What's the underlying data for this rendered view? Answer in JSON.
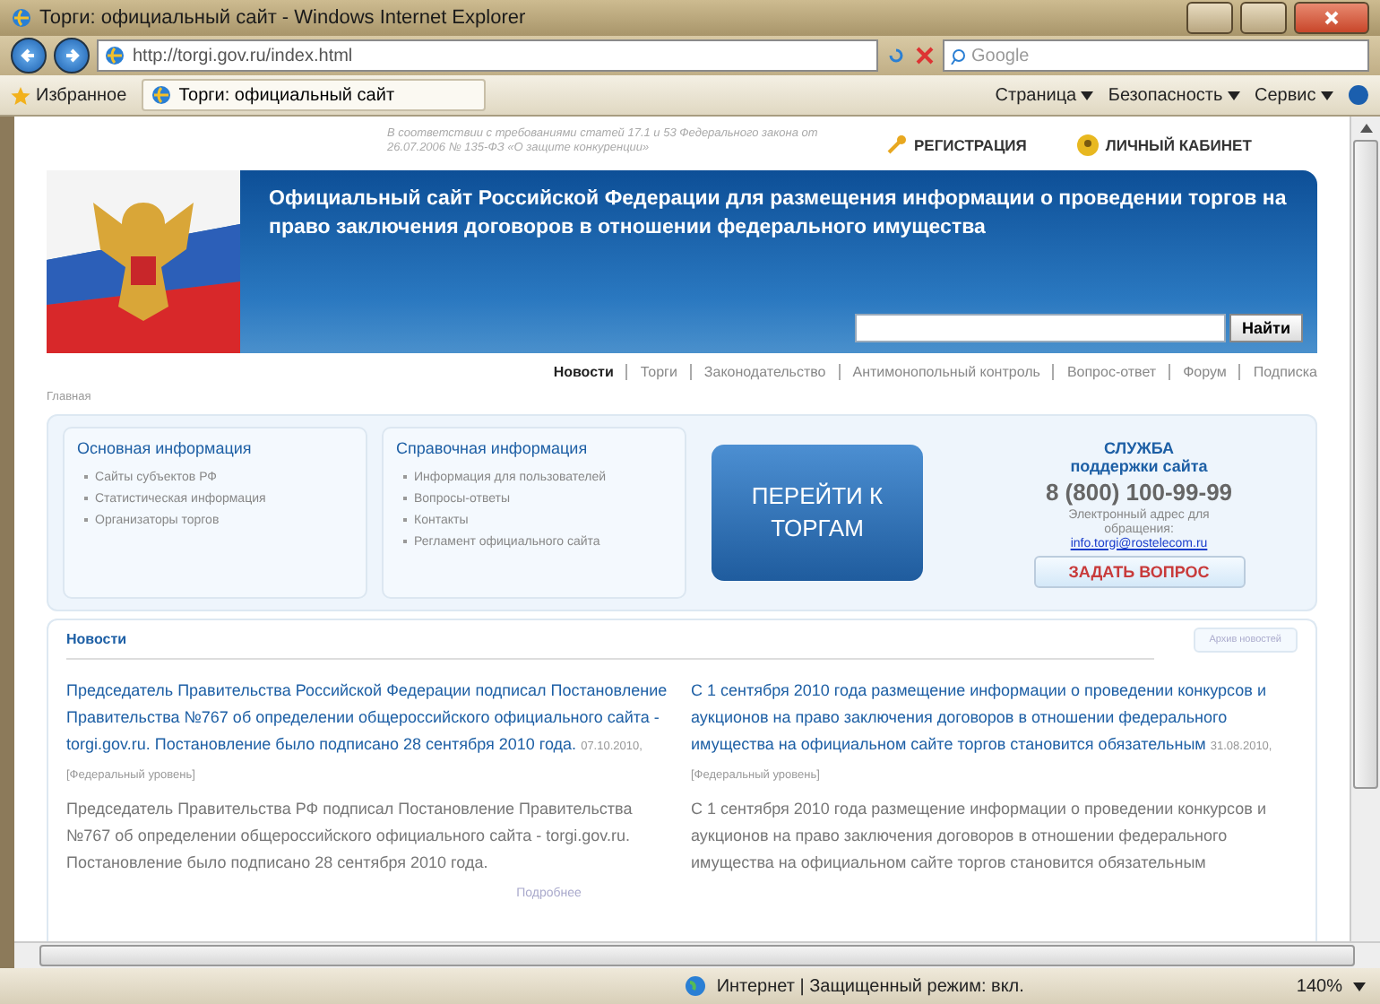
{
  "window": {
    "title": "Торги: официальный сайт - Windows Internet Explorer"
  },
  "address_bar": {
    "url": "http://torgi.gov.ru/index.html",
    "search_placeholder": "Google"
  },
  "favorites_bar": {
    "favorites": "Избранное",
    "tab": "Торги: официальный сайт",
    "menus": [
      "Страница",
      "Безопасность",
      "Сервис"
    ]
  },
  "page": {
    "notice": "В соответствии с требованиями статей 17.1 и 53 Федерального закона от 26.07.2006 № 135-ФЗ «О защите конкуренции»",
    "top_links": [
      {
        "label": "РЕГИСТРАЦИЯ",
        "kind": "key"
      },
      {
        "label": "ЛИЧНЫЙ КАБИНЕТ",
        "kind": "user"
      }
    ],
    "banner_title": "Официальный сайт Российской Федерации для размещения информации о проведении торгов на право заключения договоров в отношении федерального имущества",
    "search_button": "Найти",
    "nav": [
      {
        "label": "Новости",
        "selected": true
      },
      {
        "label": "Торги",
        "selected": false
      },
      {
        "label": "Законодательство",
        "selected": false
      },
      {
        "label": "Антимонопольный контроль",
        "selected": false
      },
      {
        "label": "Вопрос-ответ",
        "selected": false
      },
      {
        "label": "Форум",
        "selected": false
      },
      {
        "label": "Подписка",
        "selected": false
      }
    ],
    "breadcrumb": "Главная",
    "info_boxes": [
      {
        "title": "Основная информация",
        "items": [
          "Сайты субъектов РФ",
          "Статистическая информация",
          "Организаторы торгов"
        ]
      },
      {
        "title": "Справочная информация",
        "items": [
          "Информация для пользователей",
          "Вопросы-ответы",
          "Контакты",
          "Регламент официального сайта"
        ]
      }
    ],
    "big_button": "ПЕРЕЙТИ К ТОРГАМ",
    "support": {
      "title": "СЛУЖБА",
      "subtitle": "поддержки сайта",
      "phone": "8 (800) 100-99-99",
      "email_label": "Электронный адрес для обращения:",
      "email": "info.torgi@rostelecom.ru",
      "ask_button": "ЗАДАТЬ ВОПРОС"
    },
    "news": {
      "title": "Новости",
      "archive_button": "Архив новостей",
      "more_link": "Подробнее",
      "items": [
        {
          "headline": "Председатель Правительства Российской Федерации подписал Постановление Правительства №767 об определении общероссийского официального сайта - torgi.gov.ru. Постановление было подписано 28 сентября 2010 года.",
          "meta": "07.10.2010, [Федеральный уровень]",
          "body": "Председатель Правительства РФ подписал Постановление Правительства №767 об определении общероссийского официального сайта - torgi.gov.ru. Постановление было подписано 28 сентября 2010 года."
        },
        {
          "headline": "С 1 сентября 2010 года размещение информации о проведении конкурсов и аукционов на право заключения договоров в отношении федерального имущества на официальном сайте торгов становится обязательным",
          "meta": "31.08.2010, [Федеральный уровень]",
          "body": "С 1 сентября 2010 года размещение информации о проведении конкурсов и аукционов на право заключения договоров в отношении федерального имущества на официальном сайте торгов становится обязательным"
        }
      ]
    }
  },
  "status_bar": {
    "zone": "Интернет | Защищенный режим: вкл.",
    "zoom": "140%"
  }
}
